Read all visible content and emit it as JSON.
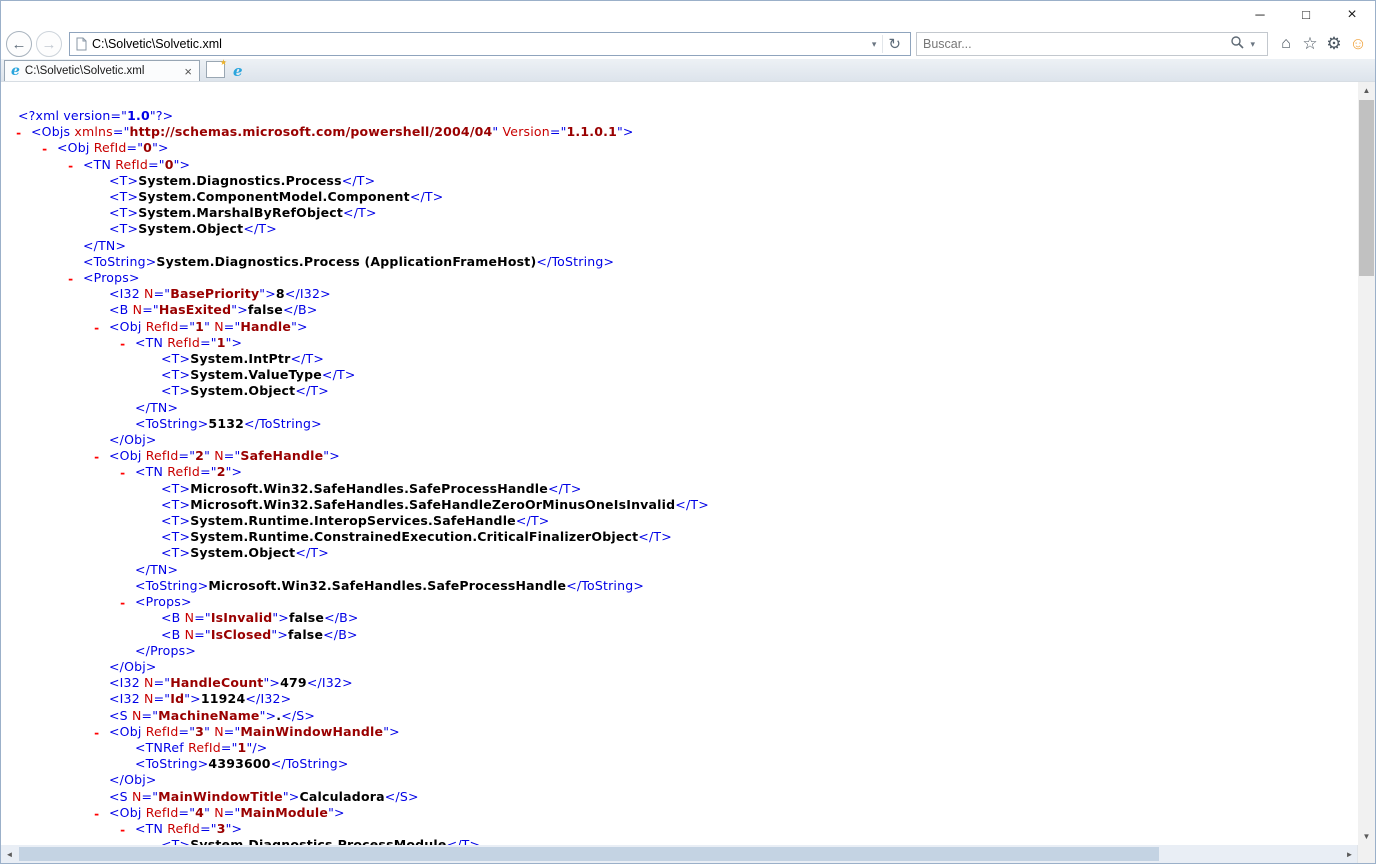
{
  "window": {
    "minimize_glyph": "─",
    "maximize_glyph": "□",
    "close_glyph": "×"
  },
  "browser": {
    "back_glyph": "←",
    "forward_glyph": "→",
    "address": {
      "url": "C:\\Solvetic\\Solvetic.xml",
      "dropdown_glyph": "▾",
      "refresh_glyph": "↻"
    },
    "search": {
      "placeholder": "Buscar...",
      "dropdown_glyph": "▾"
    },
    "toolbar": {
      "home_glyph": "⌂",
      "favorites_glyph": "☆",
      "settings_glyph": "⚙",
      "feedback_glyph": "☺"
    },
    "tab": {
      "favicon_glyph": "e",
      "title": "C:\\Solvetic\\Solvetic.xml",
      "close_glyph": "×"
    },
    "new_tab_star_glyph": "★",
    "ie_icon_glyph": "e"
  },
  "scrollbar": {
    "up_glyph": "▲",
    "down_glyph": "▼",
    "left_glyph": "◄",
    "right_glyph": "►"
  },
  "xml_view": {
    "collapse_marker": "-"
  },
  "colors": {
    "xml_markup": "#0000e6",
    "xml_attr_name": "#c80000",
    "xml_attr_value": "#990000",
    "xml_text": "#000000",
    "xml_marker": "#ff0000",
    "ie_blue": "#2aa5dd",
    "smiley": "#f0a23c"
  },
  "xml_lines": [
    {
      "d": -0.5,
      "b": 0,
      "p": [
        [
          "pi",
          "<?xml version=\""
        ],
        [
          "pv",
          "1.0"
        ],
        [
          "pi",
          "\"?>"
        ]
      ]
    },
    {
      "d": 0,
      "b": 1,
      "p": [
        [
          "m",
          "<Objs "
        ],
        [
          "n",
          "xmlns"
        ],
        [
          "m",
          "=\""
        ],
        [
          "v",
          "http://schemas.microsoft.com/powershell/2004/04"
        ],
        [
          "m",
          "\" "
        ],
        [
          "n",
          "Version"
        ],
        [
          "m",
          "=\""
        ],
        [
          "v",
          "1.1.0.1"
        ],
        [
          "m",
          "\">"
        ]
      ]
    },
    {
      "d": 1,
      "b": 1,
      "p": [
        [
          "m",
          "<Obj "
        ],
        [
          "n",
          "RefId"
        ],
        [
          "m",
          "=\""
        ],
        [
          "v",
          "0"
        ],
        [
          "m",
          "\">"
        ]
      ]
    },
    {
      "d": 2,
      "b": 1,
      "p": [
        [
          "m",
          "<TN "
        ],
        [
          "n",
          "RefId"
        ],
        [
          "m",
          "=\""
        ],
        [
          "v",
          "0"
        ],
        [
          "m",
          "\">"
        ]
      ]
    },
    {
      "d": 3,
      "b": 0,
      "p": [
        [
          "m",
          "<T>"
        ],
        [
          "tx",
          "System.Diagnostics.Process"
        ],
        [
          "m",
          "</T>"
        ]
      ]
    },
    {
      "d": 3,
      "b": 0,
      "p": [
        [
          "m",
          "<T>"
        ],
        [
          "tx",
          "System.ComponentModel.Component"
        ],
        [
          "m",
          "</T>"
        ]
      ]
    },
    {
      "d": 3,
      "b": 0,
      "p": [
        [
          "m",
          "<T>"
        ],
        [
          "tx",
          "System.MarshalByRefObject"
        ],
        [
          "m",
          "</T>"
        ]
      ]
    },
    {
      "d": 3,
      "b": 0,
      "p": [
        [
          "m",
          "<T>"
        ],
        [
          "tx",
          "System.Object"
        ],
        [
          "m",
          "</T>"
        ]
      ]
    },
    {
      "d": 2,
      "b": 0,
      "p": [
        [
          "m",
          "</TN>"
        ]
      ]
    },
    {
      "d": 2,
      "b": 0,
      "p": [
        [
          "m",
          "<ToString>"
        ],
        [
          "tx",
          "System.Diagnostics.Process (ApplicationFrameHost)"
        ],
        [
          "m",
          "</ToString>"
        ]
      ]
    },
    {
      "d": 2,
      "b": 1,
      "p": [
        [
          "m",
          "<Props>"
        ]
      ]
    },
    {
      "d": 3,
      "b": 0,
      "p": [
        [
          "m",
          "<I32 "
        ],
        [
          "n",
          "N"
        ],
        [
          "m",
          "=\""
        ],
        [
          "v",
          "BasePriority"
        ],
        [
          "m",
          "\">"
        ],
        [
          "tx",
          "8"
        ],
        [
          "m",
          "</I32>"
        ]
      ]
    },
    {
      "d": 3,
      "b": 0,
      "p": [
        [
          "m",
          "<B "
        ],
        [
          "n",
          "N"
        ],
        [
          "m",
          "=\""
        ],
        [
          "v",
          "HasExited"
        ],
        [
          "m",
          "\">"
        ],
        [
          "tx",
          "false"
        ],
        [
          "m",
          "</B>"
        ]
      ]
    },
    {
      "d": 3,
      "b": 1,
      "p": [
        [
          "m",
          "<Obj "
        ],
        [
          "n",
          "RefId"
        ],
        [
          "m",
          "=\""
        ],
        [
          "v",
          "1"
        ],
        [
          "m",
          "\" "
        ],
        [
          "n",
          "N"
        ],
        [
          "m",
          "=\""
        ],
        [
          "v",
          "Handle"
        ],
        [
          "m",
          "\">"
        ]
      ]
    },
    {
      "d": 4,
      "b": 1,
      "p": [
        [
          "m",
          "<TN "
        ],
        [
          "n",
          "RefId"
        ],
        [
          "m",
          "=\""
        ],
        [
          "v",
          "1"
        ],
        [
          "m",
          "\">"
        ]
      ]
    },
    {
      "d": 5,
      "b": 0,
      "p": [
        [
          "m",
          "<T>"
        ],
        [
          "tx",
          "System.IntPtr"
        ],
        [
          "m",
          "</T>"
        ]
      ]
    },
    {
      "d": 5,
      "b": 0,
      "p": [
        [
          "m",
          "<T>"
        ],
        [
          "tx",
          "System.ValueType"
        ],
        [
          "m",
          "</T>"
        ]
      ]
    },
    {
      "d": 5,
      "b": 0,
      "p": [
        [
          "m",
          "<T>"
        ],
        [
          "tx",
          "System.Object"
        ],
        [
          "m",
          "</T>"
        ]
      ]
    },
    {
      "d": 4,
      "b": 0,
      "p": [
        [
          "m",
          "</TN>"
        ]
      ]
    },
    {
      "d": 4,
      "b": 0,
      "p": [
        [
          "m",
          "<ToString>"
        ],
        [
          "tx",
          "5132"
        ],
        [
          "m",
          "</ToString>"
        ]
      ]
    },
    {
      "d": 3,
      "b": 0,
      "p": [
        [
          "m",
          "</Obj>"
        ]
      ]
    },
    {
      "d": 3,
      "b": 1,
      "p": [
        [
          "m",
          "<Obj "
        ],
        [
          "n",
          "RefId"
        ],
        [
          "m",
          "=\""
        ],
        [
          "v",
          "2"
        ],
        [
          "m",
          "\" "
        ],
        [
          "n",
          "N"
        ],
        [
          "m",
          "=\""
        ],
        [
          "v",
          "SafeHandle"
        ],
        [
          "m",
          "\">"
        ]
      ]
    },
    {
      "d": 4,
      "b": 1,
      "p": [
        [
          "m",
          "<TN "
        ],
        [
          "n",
          "RefId"
        ],
        [
          "m",
          "=\""
        ],
        [
          "v",
          "2"
        ],
        [
          "m",
          "\">"
        ]
      ]
    },
    {
      "d": 5,
      "b": 0,
      "p": [
        [
          "m",
          "<T>"
        ],
        [
          "tx",
          "Microsoft.Win32.SafeHandles.SafeProcessHandle"
        ],
        [
          "m",
          "</T>"
        ]
      ]
    },
    {
      "d": 5,
      "b": 0,
      "p": [
        [
          "m",
          "<T>"
        ],
        [
          "tx",
          "Microsoft.Win32.SafeHandles.SafeHandleZeroOrMinusOneIsInvalid"
        ],
        [
          "m",
          "</T>"
        ]
      ]
    },
    {
      "d": 5,
      "b": 0,
      "p": [
        [
          "m",
          "<T>"
        ],
        [
          "tx",
          "System.Runtime.InteropServices.SafeHandle"
        ],
        [
          "m",
          "</T>"
        ]
      ]
    },
    {
      "d": 5,
      "b": 0,
      "p": [
        [
          "m",
          "<T>"
        ],
        [
          "tx",
          "System.Runtime.ConstrainedExecution.CriticalFinalizerObject"
        ],
        [
          "m",
          "</T>"
        ]
      ]
    },
    {
      "d": 5,
      "b": 0,
      "p": [
        [
          "m",
          "<T>"
        ],
        [
          "tx",
          "System.Object"
        ],
        [
          "m",
          "</T>"
        ]
      ]
    },
    {
      "d": 4,
      "b": 0,
      "p": [
        [
          "m",
          "</TN>"
        ]
      ]
    },
    {
      "d": 4,
      "b": 0,
      "p": [
        [
          "m",
          "<ToString>"
        ],
        [
          "tx",
          "Microsoft.Win32.SafeHandles.SafeProcessHandle"
        ],
        [
          "m",
          "</ToString>"
        ]
      ]
    },
    {
      "d": 4,
      "b": 1,
      "p": [
        [
          "m",
          "<Props>"
        ]
      ]
    },
    {
      "d": 5,
      "b": 0,
      "p": [
        [
          "m",
          "<B "
        ],
        [
          "n",
          "N"
        ],
        [
          "m",
          "=\""
        ],
        [
          "v",
          "IsInvalid"
        ],
        [
          "m",
          "\">"
        ],
        [
          "tx",
          "false"
        ],
        [
          "m",
          "</B>"
        ]
      ]
    },
    {
      "d": 5,
      "b": 0,
      "p": [
        [
          "m",
          "<B "
        ],
        [
          "n",
          "N"
        ],
        [
          "m",
          "=\""
        ],
        [
          "v",
          "IsClosed"
        ],
        [
          "m",
          "\">"
        ],
        [
          "tx",
          "false"
        ],
        [
          "m",
          "</B>"
        ]
      ]
    },
    {
      "d": 4,
      "b": 0,
      "p": [
        [
          "m",
          "</Props>"
        ]
      ]
    },
    {
      "d": 3,
      "b": 0,
      "p": [
        [
          "m",
          "</Obj>"
        ]
      ]
    },
    {
      "d": 3,
      "b": 0,
      "p": [
        [
          "m",
          "<I32 "
        ],
        [
          "n",
          "N"
        ],
        [
          "m",
          "=\""
        ],
        [
          "v",
          "HandleCount"
        ],
        [
          "m",
          "\">"
        ],
        [
          "tx",
          "479"
        ],
        [
          "m",
          "</I32>"
        ]
      ]
    },
    {
      "d": 3,
      "b": 0,
      "p": [
        [
          "m",
          "<I32 "
        ],
        [
          "n",
          "N"
        ],
        [
          "m",
          "=\""
        ],
        [
          "v",
          "Id"
        ],
        [
          "m",
          "\">"
        ],
        [
          "tx",
          "11924"
        ],
        [
          "m",
          "</I32>"
        ]
      ]
    },
    {
      "d": 3,
      "b": 0,
      "p": [
        [
          "m",
          "<S "
        ],
        [
          "n",
          "N"
        ],
        [
          "m",
          "=\""
        ],
        [
          "v",
          "MachineName"
        ],
        [
          "m",
          "\">"
        ],
        [
          "tx",
          "."
        ],
        [
          "m",
          "</S>"
        ]
      ]
    },
    {
      "d": 3,
      "b": 1,
      "p": [
        [
          "m",
          "<Obj "
        ],
        [
          "n",
          "RefId"
        ],
        [
          "m",
          "=\""
        ],
        [
          "v",
          "3"
        ],
        [
          "m",
          "\" "
        ],
        [
          "n",
          "N"
        ],
        [
          "m",
          "=\""
        ],
        [
          "v",
          "MainWindowHandle"
        ],
        [
          "m",
          "\">"
        ]
      ]
    },
    {
      "d": 4,
      "b": 0,
      "p": [
        [
          "m",
          "<TNRef "
        ],
        [
          "n",
          "RefId"
        ],
        [
          "m",
          "=\""
        ],
        [
          "v",
          "1"
        ],
        [
          "m",
          "\"/>"
        ]
      ]
    },
    {
      "d": 4,
      "b": 0,
      "p": [
        [
          "m",
          "<ToString>"
        ],
        [
          "tx",
          "4393600"
        ],
        [
          "m",
          "</ToString>"
        ]
      ]
    },
    {
      "d": 3,
      "b": 0,
      "p": [
        [
          "m",
          "</Obj>"
        ]
      ]
    },
    {
      "d": 3,
      "b": 0,
      "p": [
        [
          "m",
          "<S "
        ],
        [
          "n",
          "N"
        ],
        [
          "m",
          "=\""
        ],
        [
          "v",
          "MainWindowTitle"
        ],
        [
          "m",
          "\">"
        ],
        [
          "tx",
          "Calculadora"
        ],
        [
          "m",
          "</S>"
        ]
      ]
    },
    {
      "d": 3,
      "b": 1,
      "p": [
        [
          "m",
          "<Obj "
        ],
        [
          "n",
          "RefId"
        ],
        [
          "m",
          "=\""
        ],
        [
          "v",
          "4"
        ],
        [
          "m",
          "\" "
        ],
        [
          "n",
          "N"
        ],
        [
          "m",
          "=\""
        ],
        [
          "v",
          "MainModule"
        ],
        [
          "m",
          "\">"
        ]
      ]
    },
    {
      "d": 4,
      "b": 1,
      "p": [
        [
          "m",
          "<TN "
        ],
        [
          "n",
          "RefId"
        ],
        [
          "m",
          "=\""
        ],
        [
          "v",
          "3"
        ],
        [
          "m",
          "\">"
        ]
      ]
    },
    {
      "d": 5,
      "b": 0,
      "p": [
        [
          "m",
          "<T>"
        ],
        [
          "tx",
          "System.Diagnostics.ProcessModule"
        ],
        [
          "m",
          "</T>"
        ]
      ]
    }
  ]
}
